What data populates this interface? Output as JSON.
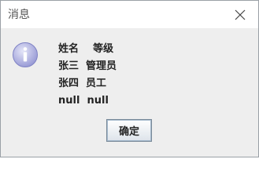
{
  "dialog": {
    "title": "消息",
    "message_lines": [
      "姓名    等级",
      "张三  管理员",
      "张四  员工",
      "null  null"
    ],
    "ok_label": "确定",
    "icon": "info-icon",
    "colors": {
      "icon_fill": "#b7b8e6",
      "icon_text": "#ffffff",
      "button_border": "#7a8a99"
    }
  }
}
